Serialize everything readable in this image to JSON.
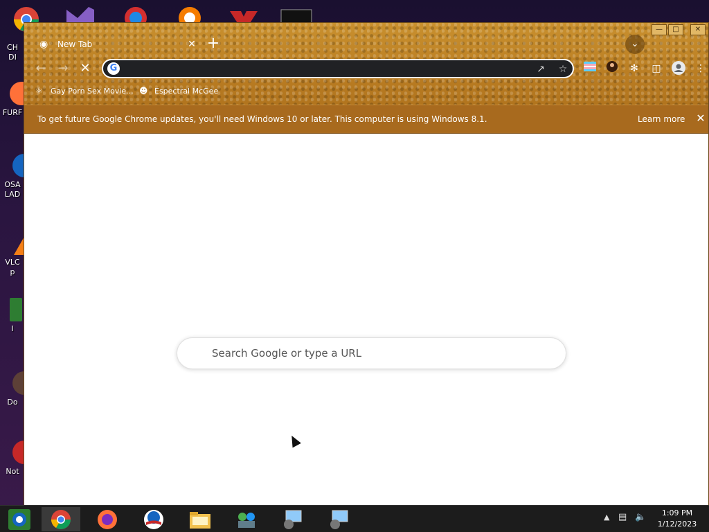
{
  "desktop": {
    "icons": [
      {
        "label": "CH",
        "label2": "DI",
        "icon": "chrome-icon"
      },
      {
        "label": "FURF",
        "icon": "firefox-icon"
      },
      {
        "label": "OSA",
        "label2": "LAD",
        "icon": "obama-icon"
      },
      {
        "label": "VLC",
        "label2": "p",
        "icon": "vlc-icon"
      },
      {
        "label": "I",
        "icon": "h-app-icon"
      },
      {
        "label": "Do",
        "icon": "doc-icon"
      },
      {
        "label": "Not",
        "icon": "dc-icon"
      }
    ]
  },
  "browser": {
    "tab_title": "New Tab",
    "omnibox_value": "",
    "bookmarks": [
      {
        "label": "Gay Porn Sex Movie...",
        "icon": "bookmark-favicon"
      },
      {
        "label": "Espectral McGee",
        "icon": "bookmark-avatar"
      }
    ],
    "infobar": {
      "message": "To get future Google Chrome updates, you'll need Windows 10 or later. This computer is using Windows 8.1.",
      "link": "Learn more"
    },
    "ntp_search_placeholder": "Search Google or type a URL"
  },
  "taskbar": {
    "time": "1:09 PM",
    "date": "1/12/2023"
  },
  "colors": {
    "theme": "#b97c22",
    "infobar": "#a86a1e",
    "omnibox": "#202124",
    "taskbar": "#1c1c1c"
  }
}
